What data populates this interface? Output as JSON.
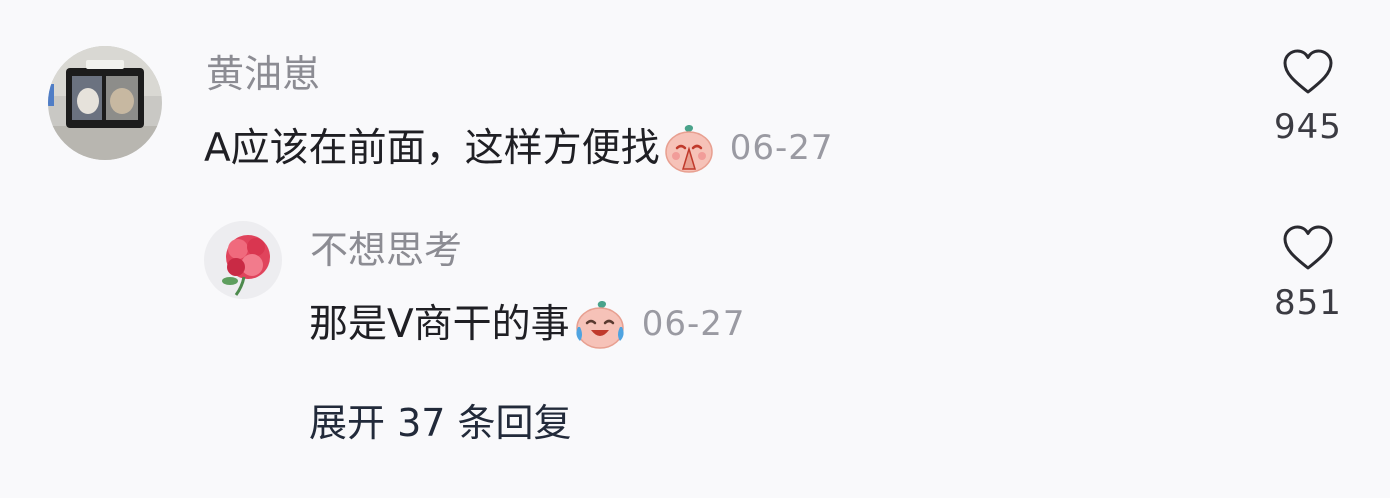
{
  "comment": {
    "username": "黄油崽",
    "text": "A应该在前面，这样方便找",
    "emoji": "praying-emoji",
    "date": "06-27",
    "likes": "945",
    "like_icon": "heart-outline-icon"
  },
  "reply": {
    "username": "不想思考",
    "text": "那是V商干的事",
    "emoji": "laughing-crying-emoji",
    "date": "06-27",
    "likes": "851",
    "like_icon": "heart-outline-icon"
  },
  "expand_replies": "展开 37 条回复",
  "colors": {
    "background": "#f9f9fb",
    "username": "#8c8c93",
    "text": "#1f1f24",
    "date": "#9a9aa2",
    "expand": "#222a3a"
  }
}
